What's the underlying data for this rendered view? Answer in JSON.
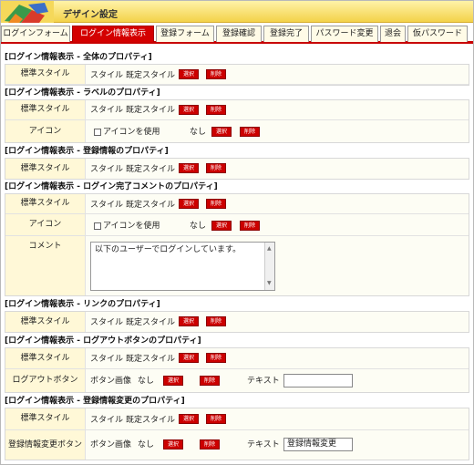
{
  "window": {
    "title": "デザイン設定"
  },
  "tabs": [
    {
      "label": "ログインフォーム",
      "active": false
    },
    {
      "label": "ログイン情報表示",
      "active": true
    },
    {
      "label": "登録フォーム",
      "active": false
    },
    {
      "label": "登録確認",
      "active": false
    },
    {
      "label": "登録完了",
      "active": false
    },
    {
      "label": "パスワード変更",
      "active": false
    },
    {
      "label": "退会",
      "active": false
    },
    {
      "label": "仮パスワード",
      "active": false
    }
  ],
  "common": {
    "select_label": "選択",
    "delete_label": "削除",
    "none_label": "なし",
    "style_prefix": "スタイル",
    "style_default": "既定スタイル",
    "use_icon": "アイコンを使用",
    "button_image": "ボタン画像",
    "text_label": "テキスト"
  },
  "sections": {
    "overall": {
      "title": "[ログイン情報表示 - 全体のプロパティ]",
      "std_label": "標準スタイル"
    },
    "label": {
      "title": "[ログイン情報表示 - ラベルのプロパティ]",
      "std_label": "標準スタイル",
      "icon_label": "アイコン"
    },
    "reginfo": {
      "title": "[ログイン情報表示 - 登録情報のプロパティ]",
      "std_label": "標準スタイル"
    },
    "complete": {
      "title": "[ログイン情報表示 - ログイン完了コメントのプロパティ]",
      "std_label": "標準スタイル",
      "icon_label": "アイコン",
      "comment_label": "コメント",
      "comment_value": "以下のユーザーでログインしています。"
    },
    "link": {
      "title": "[ログイン情報表示 - リンクのプロパティ]",
      "std_label": "標準スタイル"
    },
    "logout": {
      "title": "[ログイン情報表示 - ログアウトボタンのプロパティ]",
      "std_label": "標準スタイル",
      "button_label": "ログアウトボタン",
      "text_value": ""
    },
    "regchange": {
      "title": "[ログイン情報表示 - 登録情報変更のプロパティ]",
      "std_label": "標準スタイル",
      "button_label": "登録情報変更ボタン",
      "text_value": "登録情報変更"
    }
  },
  "colors": {
    "accent": "#cc0000",
    "titlebar": "#f3d24a",
    "label_bg": "#fff8d7"
  }
}
